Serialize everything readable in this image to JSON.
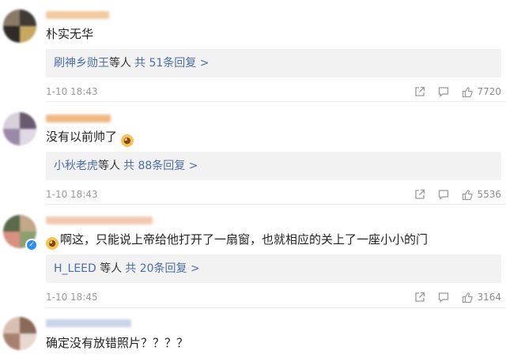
{
  "comments": [
    {
      "text": "朴实无华",
      "reply_users": "刷神乡勋王",
      "reply_deng": "等人",
      "reply_count": "共 51条回复 >",
      "time": "1-10 18:43",
      "likes": "7720"
    },
    {
      "text": "没有以前帅了",
      "reply_users": "小秋老虎",
      "reply_deng": "等人",
      "reply_count": "共 88条回复 >",
      "time": "1-10 18:43",
      "likes": "5536"
    },
    {
      "text": "啊这，只能说上帝给他打开了一扇窗，也就相应的关上了一座小小的门",
      "reply_users": "H_LEED",
      "reply_deng": " 等人",
      "reply_count": "共 20条回复 >",
      "time": "1-10 18:45",
      "likes": "3164"
    },
    {
      "text": "确定没有放错照片？？？？"
    }
  ],
  "icons": {
    "share": "share-icon",
    "comment": "comment-icon",
    "like": "like-icon"
  },
  "colors": {
    "link": "#4a6fa8",
    "reply_bg": "#f2f2f2",
    "meta": "#9a9a9a",
    "verified": "#2f8cf0"
  }
}
